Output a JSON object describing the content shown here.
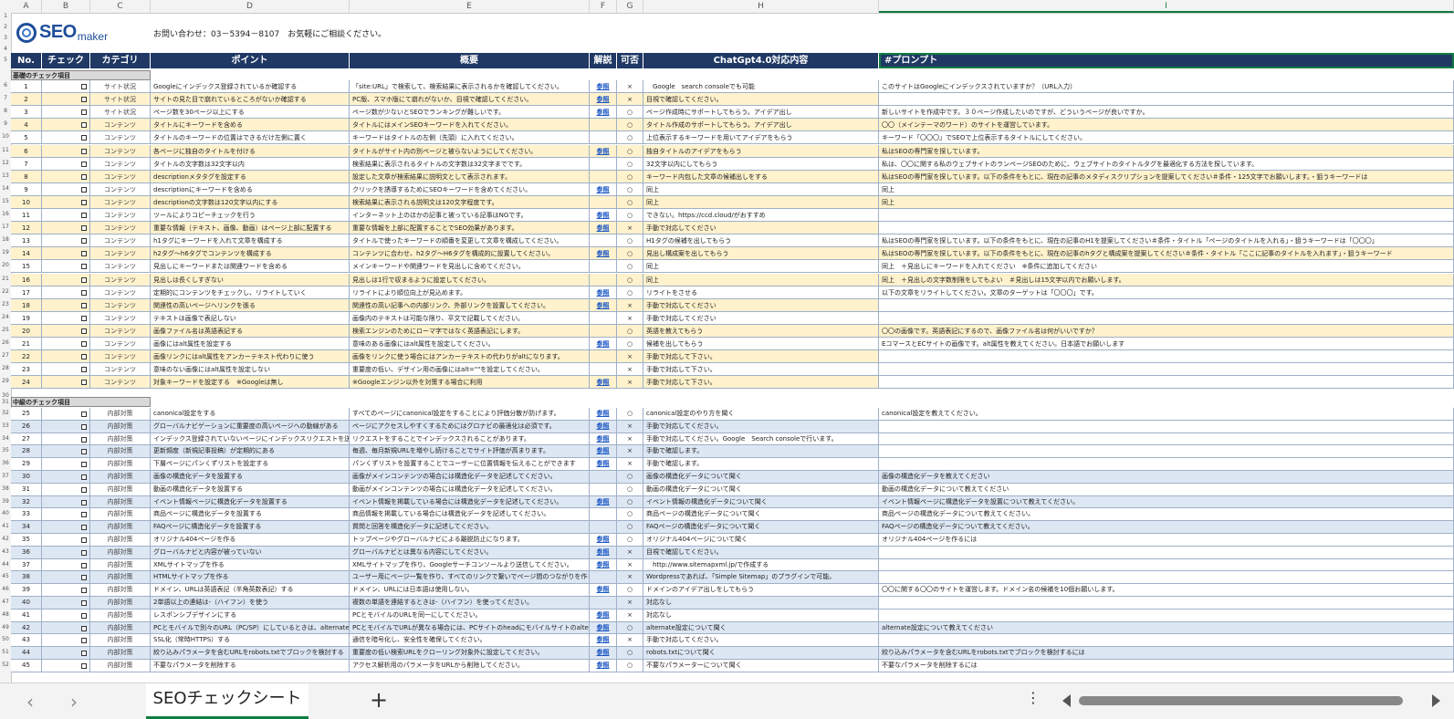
{
  "column_letters": [
    "A",
    "B",
    "C",
    "D",
    "E",
    "F",
    "G",
    "H",
    "I"
  ],
  "banner": {
    "logo_text": "SEO",
    "logo_sub": "maker",
    "contact": "お問い合わせ：03－5394－8107　お気軽にご相談ください。"
  },
  "headers": [
    "No.",
    "チェック",
    "カテゴリ",
    "ポイント",
    "概要",
    "解説",
    "可否",
    "ChatGpt4.0対応内容",
    "#プロンプト"
  ],
  "section_basic": "基礎のチェック項目",
  "section_mid": "中級のチェック項目",
  "basic_rows": [
    {
      "no": "1",
      "cat": "サイト状況",
      "point": "Googleにインデックス登録されているか確認する",
      "summary": "「site:URL」で検索して、検索結果に表示されるかを確認してください。",
      "link": "参照",
      "ok": "×",
      "gpt": "　Google　search consoleでも可能",
      "prompt": "このサイトはGoogleにインデックスされていますか？（URL入力）"
    },
    {
      "no": "2",
      "cat": "サイト状況",
      "point": "サイトの見た目で崩れているところがないか確認する",
      "summary": "PC版、スマホ版にて崩れがないか、目視で確認してください。",
      "link": "参照",
      "ok": "×",
      "gpt": "目視で確認してください。",
      "prompt": ""
    },
    {
      "no": "3",
      "cat": "サイト状況",
      "point": "ページ数を30ページ以上にする",
      "summary": "ページ数が少ないとSEOでランキングが難しいです。",
      "link": "参照",
      "ok": "○",
      "gpt": "ページ作成時にサポートしてもらう。アイデア出し",
      "prompt": "新しいサイトを作成中です。３０ページ作成したいのですが、どういうページが良いですか。"
    },
    {
      "no": "4",
      "cat": "コンテンツ",
      "point": "タイトルにキーワードを含める",
      "summary": "タイトルにはメインSEOキーワードを入れてください。",
      "link": "",
      "ok": "○",
      "gpt": "タイトル作成のサポートしてもらう。アイデア出し",
      "prompt": "〇〇（メインテーマのワード）のサイトを運営しています。"
    },
    {
      "no": "5",
      "cat": "コンテンツ",
      "point": "タイトルのキーワードの位置はできるだけ左側に置く",
      "summary": "キーワードはタイトルの左側（先頭）に入れてください。",
      "link": "",
      "ok": "○",
      "gpt": "上位表示するキーワードを用いてアイデアをもらう",
      "prompt": "キーワード「〇〇〇」でSEOで上位表示するタイトルにしてください。"
    },
    {
      "no": "6",
      "cat": "コンテンツ",
      "point": "各ページに独自のタイトルを付ける",
      "summary": "タイトルがサイト内の別ページと被らないようにしてください。",
      "link": "参照",
      "ok": "○",
      "gpt": "独自タイトルのアイデアをもらう",
      "prompt": "私はSEOの専門家を探しています。"
    },
    {
      "no": "7",
      "cat": "コンテンツ",
      "point": "タイトルの文字数は32文字以内",
      "summary": "検索結果に表示されるタイトルの文字数は32文字までです。",
      "link": "",
      "ok": "○",
      "gpt": "32文字以内にしてもらう",
      "prompt": "私は、〇〇に関する私のウェブサイトのランページSEOのために、ウェブサイトのタイトルタグを最適化する方法を探しています。"
    },
    {
      "no": "8",
      "cat": "コンテンツ",
      "point": "descriptionメタタグを設定する",
      "summary": "設定した文章が検索結果に説明文として表示されます。",
      "link": "",
      "ok": "○",
      "gpt": "キーワード内包した文章の候補出しをする",
      "prompt": "私はSEOの専門家を探しています。以下の条件をもとに、現在の記事のメタディスクリプションを提案してください＃条件・125文字でお願いします。・狙うキーワードは"
    },
    {
      "no": "9",
      "cat": "コンテンツ",
      "point": "descriptionにキーワードを含める",
      "summary": "クリックを誘導するためにSEOキーワードを含めてください。",
      "link": "参照",
      "ok": "○",
      "gpt": "同上",
      "prompt": "同上"
    },
    {
      "no": "10",
      "cat": "コンテンツ",
      "point": "descriptionの文字数は120文字以内にする",
      "summary": "検索結果に表示される説明文は120文字程度です。",
      "link": "",
      "ok": "○",
      "gpt": "同上",
      "prompt": "同上"
    },
    {
      "no": "11",
      "cat": "コンテンツ",
      "point": "ツールによりコピーチェックを行う",
      "summary": "インターネット上のほかの記事と被っている記事はNGです。",
      "link": "参照",
      "ok": "○",
      "gpt": "できない。https://ccd.cloud/がおすすめ",
      "prompt": ""
    },
    {
      "no": "12",
      "cat": "コンテンツ",
      "point": "重要な情報（テキスト、画像、動画）はページ上部に配置する",
      "summary": "重要な情報を上部に配置することでSEO効果があります。",
      "link": "参照",
      "ok": "×",
      "gpt": "手動で対応してください",
      "prompt": ""
    },
    {
      "no": "13",
      "cat": "コンテンツ",
      "point": "h1タグにキーワードを入れて文章を構成する",
      "summary": "タイトルで使ったキーワードの順番を変更して文章を構成してください。",
      "link": "",
      "ok": "○",
      "gpt": "H1タグの候補を出してもらう",
      "prompt": "私はSEOの専門家を探しています。以下の条件をもとに、現在の記事のH1を提案してください＃条件・タイトル「ページのタイトルを入れる」・狙うキーワードは「〇〇〇」"
    },
    {
      "no": "14",
      "cat": "コンテンツ",
      "point": "h2タグ〜h6タグでコンテンツを構成する",
      "summary": "コンテンツに合わせ、h2タグ〜H6タグを構成的に設置してください。",
      "link": "参照",
      "ok": "○",
      "gpt": "見出し構成案を出してもらう",
      "prompt": "私はSEOの専門家を探しています。以下の条件をもとに、現在の記事のhタグと構成案を提案してください＃条件・タイトル「ここに記事のタイトルを入れます」・狙うキーワード"
    },
    {
      "no": "15",
      "cat": "コンテンツ",
      "point": "見出しにキーワードまたは関連ワードを含める",
      "summary": "メインキーワードや関連ワードを見出しに含めてください。",
      "link": "",
      "ok": "○",
      "gpt": "同上",
      "prompt": "同上　＋見出しにキーワードを入れてください　※条件に追加してください"
    },
    {
      "no": "16",
      "cat": "コンテンツ",
      "point": "見出しは長くしすぎない",
      "summary": "見出しは1行で収まるように設定してください。",
      "link": "",
      "ok": "○",
      "gpt": "同上",
      "prompt": "同上　＋見出しの文字数制限をしてもよい　＃見出しは15文字以内でお願いします。"
    },
    {
      "no": "17",
      "cat": "コンテンツ",
      "point": "定期的にコンテンツをチェックし、リライトしていく",
      "summary": "リライトにより順位向上が見込めます。",
      "link": "参照",
      "ok": "○",
      "gpt": "リライトをさせる",
      "prompt": "以下の文章をリライトしてください。文章のターゲットは「〇〇〇」です。"
    },
    {
      "no": "18",
      "cat": "コンテンツ",
      "point": "関連性の高いページへリンクを張る",
      "summary": "関連性の高い記事への内部リンク、外部リンクを設置してください。",
      "link": "参照",
      "ok": "×",
      "gpt": "手動で対応してください",
      "prompt": ""
    },
    {
      "no": "19",
      "cat": "コンテンツ",
      "point": "テキストは画像で表記しない",
      "summary": "画像内のテキストは可能な限り、平文で記載してください。",
      "link": "",
      "ok": "×",
      "gpt": "手動で対応してください",
      "prompt": ""
    },
    {
      "no": "20",
      "cat": "コンテンツ",
      "point": "画像ファイル名は英語表記する",
      "summary": "検索エンジンのためにローマ字ではなく英語表記にします。",
      "link": "",
      "ok": "○",
      "gpt": "英語を教えてもらう",
      "prompt": "〇〇の画像です。英語表記にするので、画像ファイル名は何がいいですか？"
    },
    {
      "no": "21",
      "cat": "コンテンツ",
      "point": "画像にはalt属性を設定する",
      "summary": "意味のある画像にはalt属性を設定してください。",
      "link": "参照",
      "ok": "○",
      "gpt": "候補を出してもらう",
      "prompt": "EコマースとECサイトの画像です。alt属性を教えてください。日本語でお願いします"
    },
    {
      "no": "22",
      "cat": "コンテンツ",
      "point": "画像リンクにはalt属性をアンカーテキスト代わりに使う",
      "summary": "画像をリンクに使う場合にはアンカーテキストの代わりがaltになります。",
      "link": "",
      "ok": "×",
      "gpt": "手動で対応して下さい。",
      "prompt": ""
    },
    {
      "no": "23",
      "cat": "コンテンツ",
      "point": "意味のない画像にはalt属性を設定しない",
      "summary": "重要度の低い、デザイン用の画像にはalt=\"\"を設定してください。",
      "link": "",
      "ok": "×",
      "gpt": "手動で対応して下さい。",
      "prompt": ""
    },
    {
      "no": "24",
      "cat": "コンテンツ",
      "point": "対象キーワードを設定する　※Googleは無し",
      "summary": "※Googleエンジン以外を対策する場合に利用",
      "link": "参照",
      "ok": "×",
      "gpt": "手動で対応して下さい。",
      "prompt": ""
    }
  ],
  "mid_rows": [
    {
      "no": "25",
      "cat": "内部対策",
      "point": "canonical設定をする",
      "summary": "すべてのページにcanonical設定をすることにより評価分散が防げます。",
      "link": "参照",
      "ok": "○",
      "gpt": "canonical設定のやり方を聞く",
      "prompt": "canonical設定を教えてください。"
    },
    {
      "no": "26",
      "cat": "内部対策",
      "point": "グローバルナビゲーションに重要度の高いページへの動線がある",
      "summary": "ページにアクセスしやすくするためにはグロナビの最適化は必須です。",
      "link": "参照",
      "ok": "×",
      "gpt": "手動で対応してください。",
      "prompt": ""
    },
    {
      "no": "27",
      "cat": "内部対策",
      "point": "インデックス登録されていないページにインデックスリクエストを送る",
      "summary": "リクエストをすることでインデックスされることがあります。",
      "link": "参照",
      "ok": "×",
      "gpt": "手動で対応してください。Google　Search consoleで行います。",
      "prompt": ""
    },
    {
      "no": "28",
      "cat": "内部対策",
      "point": "更新頻度（新規記事投稿）が定期的にある",
      "summary": "毎週、毎月新規URLを増やし続けることでサイト評価が高まります。",
      "link": "参照",
      "ok": "×",
      "gpt": "手動で確認します。",
      "prompt": ""
    },
    {
      "no": "29",
      "cat": "内部対策",
      "point": "下層ページにパンくずリストを設定する",
      "summary": "パンくずリストを設置することでユーザーに位置情報を伝えることができます",
      "link": "参照",
      "ok": "×",
      "gpt": "手動で確認します。",
      "prompt": ""
    },
    {
      "no": "30",
      "cat": "内部対策",
      "point": "画像の構造化データを設置する",
      "summary": "画像がメインコンテンツの場合には構造化データを記述してください。",
      "link": "",
      "ok": "○",
      "gpt": "画像の構造化データについて聞く",
      "prompt": "画像の構造化データを教えてください"
    },
    {
      "no": "31",
      "cat": "内部対策",
      "point": "動画の構造化データを設置する",
      "summary": "動画がメインコンテンツの場合には構造化データを記述してください。",
      "link": "",
      "ok": "○",
      "gpt": "動画の構造化データについて聞く",
      "prompt": "動画の構造化データについて教えてください"
    },
    {
      "no": "32",
      "cat": "内部対策",
      "point": "イベント情報ページに構造化データを設置する",
      "summary": "イベント情報を掲載している場合には構造化データを記述してください。",
      "link": "参照",
      "ok": "○",
      "gpt": "イベント情報の構造化データについて聞く",
      "prompt": "イベント情報ページに構造化データを設置について教えてください。"
    },
    {
      "no": "33",
      "cat": "内部対策",
      "point": "商品ページに構造化データを設置する",
      "summary": "商品情報を掲載している場合には構造化データを記述してください。",
      "link": "",
      "ok": "○",
      "gpt": "商品ページの構造化データについて聞く",
      "prompt": "商品ページの構造化データについて教えてください。"
    },
    {
      "no": "34",
      "cat": "内部対策",
      "point": "FAQページに構造化データを設置する",
      "summary": "質問と回答を構造化データに記述してください。",
      "link": "",
      "ok": "○",
      "gpt": "FAQページの構造化データについて聞く",
      "prompt": "FAQページの構造化データについて教えてください。"
    },
    {
      "no": "35",
      "cat": "内部対策",
      "point": "オリジナル404ページを作る",
      "summary": "トップページやグローバルナビによる離脱防止になります。",
      "link": "参照",
      "ok": "○",
      "gpt": "オリジナル404ページについて聞く",
      "prompt": "オリジナル404ページを作るには"
    },
    {
      "no": "36",
      "cat": "内部対策",
      "point": "グローバルナビと内容が被っていない",
      "summary": "グローバルナビとは異なる内容にしてください。",
      "link": "参照",
      "ok": "×",
      "gpt": "目視で確認してください。",
      "prompt": ""
    },
    {
      "no": "37",
      "cat": "内部対策",
      "point": "XMLサイトマップを作る",
      "summary": "XMLサイトマップを作り、Googleサーチコンソールより送信してください。",
      "link": "参照",
      "ok": "×",
      "gpt": "　http://www.sitemapxml.jp/で作成する",
      "prompt": ""
    },
    {
      "no": "38",
      "cat": "内部対策",
      "point": "HTMLサイトマップを作る",
      "summary": "ユーザー用にページ一覧を作り、すべてのリンクで繋いでページ間のつながりを作ってください。",
      "link": "",
      "ok": "×",
      "gpt": "Wordpressであれば、「Simple Sitemap」のプラグインで可能。",
      "prompt": ""
    },
    {
      "no": "39",
      "cat": "内部対策",
      "point": "ドメイン、URLは英語表記（半角英数表記）する",
      "summary": "ドメイン、URLには日本語は使用しない。",
      "link": "参照",
      "ok": "○",
      "gpt": "ドメインのアイデア出しをしてもらう",
      "prompt": "〇〇に関する〇〇のサイトを運営します。ドメイン名の候補を10個お願いします。"
    },
    {
      "no": "40",
      "cat": "内部対策",
      "point": "2単語以上の連結は-（ハイフン）を使う",
      "summary": "複数の単語を連結するときは-（ハイフン）を使ってください。",
      "link": "",
      "ok": "×",
      "gpt": "対応なし",
      "prompt": ""
    },
    {
      "no": "41",
      "cat": "内部対策",
      "point": "レスポンシブデザインにする",
      "summary": "PCとモバイルのURLを同一にしてください。",
      "link": "参照",
      "ok": "×",
      "gpt": "対応なし",
      "prompt": ""
    },
    {
      "no": "42",
      "cat": "内部対策",
      "point": "PCとモバイルで別々のURL（PC/SP）にしているときは、alternateでalternate設定をする",
      "summary": "PCとモバイルでURLが異なる場合には、PCサイトのheadにモバイルサイトのalternateURL設定をします",
      "link": "参照",
      "ok": "○",
      "gpt": "alternate設定について聞く",
      "prompt": "alternate設定について教えてください"
    },
    {
      "no": "43",
      "cat": "内部対策",
      "point": "SSL化（常時HTTPS）する",
      "summary": "通信を暗号化し、安全性を確保してください。",
      "link": "参照",
      "ok": "×",
      "gpt": "手動で対応してください。",
      "prompt": ""
    },
    {
      "no": "44",
      "cat": "内部対策",
      "point": "絞り込みパラメータを含むURLをrobots.txtでブロックを検討する",
      "summary": "重要度の低い検索URLをクローリング対象外に設定してください。",
      "link": "参照",
      "ok": "○",
      "gpt": "robots.txtについて聞く",
      "prompt": "絞り込みパラメータを含むURLをrobots.txtでブロックを検討するには"
    },
    {
      "no": "45",
      "cat": "内部対策",
      "point": "不要なパラメータを削除する",
      "summary": "アクセス解析用のパラメータをURLから削除してください。",
      "link": "参照",
      "ok": "○",
      "gpt": "不要なパラメーターについて聞く",
      "prompt": "不要なパラメータを削除するには"
    }
  ],
  "sheet_tab": "SEOチェックシート",
  "icons": {
    "prev": "chevron-left-icon",
    "next": "chevron-right-icon",
    "add": "plus-icon",
    "more": "more-vertical-icon"
  },
  "colors": {
    "header_bg": "#1f3864",
    "basic_alt": "#fff2cc",
    "mid_alt": "#dde7f3",
    "accent": "#107c41"
  }
}
